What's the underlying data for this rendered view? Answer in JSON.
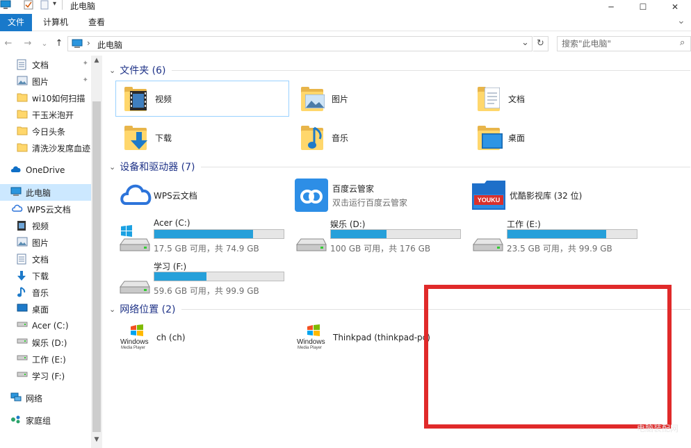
{
  "window": {
    "title": "此电脑",
    "controls": {
      "minimize": "─",
      "maximize": "☐",
      "close": "✕"
    }
  },
  "ribbon": {
    "tabs": [
      {
        "label": "文件",
        "active": true
      },
      {
        "label": "计算机",
        "active": false
      },
      {
        "label": "查看",
        "active": false
      }
    ],
    "expand": "⌄"
  },
  "address": {
    "back": "←",
    "forward": "→",
    "recent": "⌄",
    "up": "↑",
    "separator": "›",
    "path": "此电脑",
    "dropdown": "⌄",
    "refresh": "↻",
    "search_placeholder": "搜索\"此电脑\"",
    "search_icon": "⌕"
  },
  "sidebar": {
    "quick_access": [
      {
        "label": "文档",
        "icon": "document-icon",
        "pinned": true
      },
      {
        "label": "图片",
        "icon": "pictures-icon",
        "pinned": true
      },
      {
        "label": "wi10如何扫描",
        "icon": "folder-icon",
        "pinned": false
      },
      {
        "label": "干玉米泡开",
        "icon": "folder-icon",
        "pinned": false
      },
      {
        "label": "今日头条",
        "icon": "folder-icon",
        "pinned": false
      },
      {
        "label": "清洗沙发席血迹",
        "icon": "folder-icon",
        "pinned": false
      }
    ],
    "onedrive": "OneDrive",
    "this_pc": "此电脑",
    "pc_items": [
      {
        "label": "WPS云文档",
        "icon": "wps-cloud-icon"
      },
      {
        "label": "视频",
        "icon": "video-icon"
      },
      {
        "label": "图片",
        "icon": "pictures-icon"
      },
      {
        "label": "文档",
        "icon": "document-icon"
      },
      {
        "label": "下载",
        "icon": "download-icon"
      },
      {
        "label": "音乐",
        "icon": "music-icon"
      },
      {
        "label": "桌面",
        "icon": "desktop-icon"
      },
      {
        "label": "Acer (C:)",
        "icon": "drive-icon"
      },
      {
        "label": "娱乐 (D:)",
        "icon": "drive-icon"
      },
      {
        "label": "工作 (E:)",
        "icon": "drive-icon"
      },
      {
        "label": "学习 (F:)",
        "icon": "drive-icon"
      }
    ],
    "network": "网络",
    "homegroup": "家庭组",
    "pin_glyph": "📌",
    "scroll_up": "▲",
    "scroll_down": "▼"
  },
  "main": {
    "folders_header": "文件夹 (6)",
    "folders": [
      {
        "label": "视频",
        "icon": "video-folder-icon",
        "selected": true
      },
      {
        "label": "图片",
        "icon": "pictures-folder-icon",
        "selected": false
      },
      {
        "label": "文档",
        "icon": "documents-folder-icon",
        "selected": false
      },
      {
        "label": "下载",
        "icon": "downloads-folder-icon",
        "selected": false
      },
      {
        "label": "音乐",
        "icon": "music-folder-icon",
        "selected": false
      },
      {
        "label": "桌面",
        "icon": "desktop-folder-icon",
        "selected": false
      }
    ],
    "devices_header": "设备和驱动器 (7)",
    "apps": [
      {
        "label": "WPS云文档",
        "sub": "",
        "icon": "wps-cloud-icon"
      },
      {
        "label": "百度云管家",
        "sub": "双击运行百度云管家",
        "icon": "baidu-cloud-icon"
      },
      {
        "label": "优酷影视库 (32 位)",
        "sub": "",
        "icon": "youku-icon",
        "badge": "YOUKU"
      }
    ],
    "drives": [
      {
        "name": "Acer (C:)",
        "free": "17.5 GB 可用，共 74.9 GB",
        "used_fraction": 0.766,
        "icon": "windows-drive-icon"
      },
      {
        "name": "娱乐 (D:)",
        "free": "100 GB 可用，共 176 GB",
        "used_fraction": 0.432,
        "icon": "hard-drive-icon"
      },
      {
        "name": "工作 (E:)",
        "free": "23.5 GB 可用，共 99.9 GB",
        "used_fraction": 0.765,
        "icon": "hard-drive-icon"
      },
      {
        "name": "学习 (F:)",
        "free": "59.6 GB 可用，共 99.9 GB",
        "used_fraction": 0.403,
        "icon": "hard-drive-icon"
      }
    ],
    "network_header": "网络位置 (2)",
    "network": [
      {
        "label": "ch (ch)",
        "icon": "windows-media-player-icon",
        "caption1": "Windows",
        "caption2": "Media Player"
      },
      {
        "label": "Thinkpad (thinkpad-pc)",
        "icon": "windows-media-player-icon",
        "caption1": "Windows",
        "caption2": "Media Player"
      }
    ],
    "chevron": "⌄"
  },
  "colors": {
    "accent": "#1979ca",
    "selection": "#cce8ff",
    "bar_fill": "#26a0da",
    "header_text": "#1e3287",
    "annotation": "#e02a2a"
  },
  "watermark": "电脑装配网"
}
